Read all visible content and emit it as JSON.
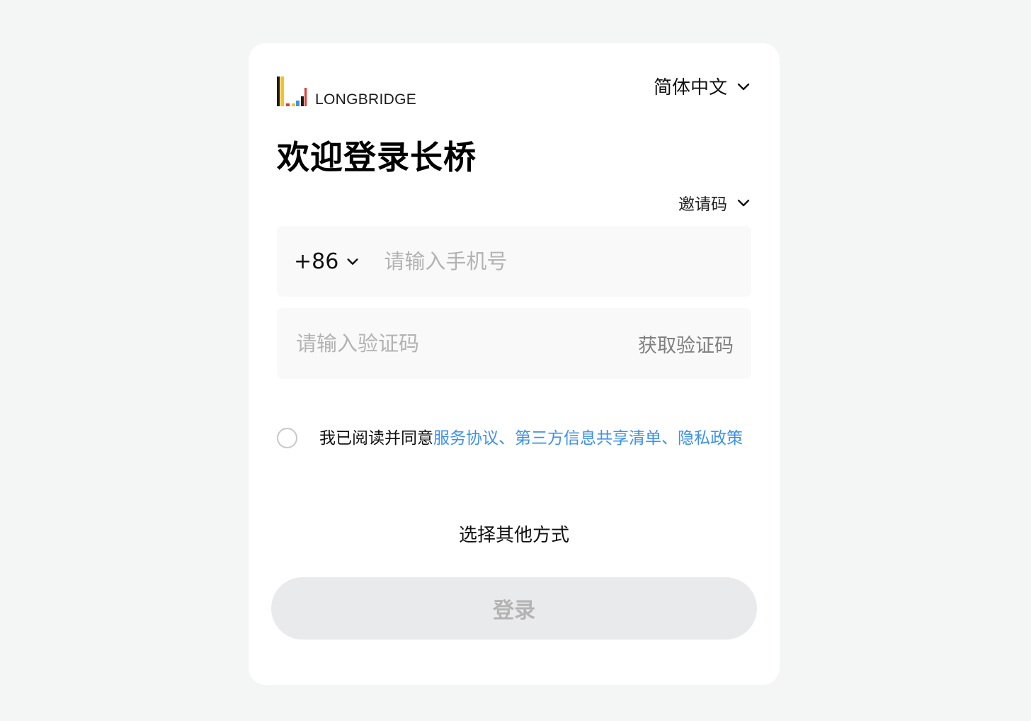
{
  "logo": {
    "text": "LONGBRIDGE",
    "colors": [
      "#f2c22e",
      "#e2382f",
      "#3e91e8",
      "#1a1a1a"
    ]
  },
  "language": {
    "label": "简体中文",
    "icon": "chevron-down-icon"
  },
  "title": "欢迎登录长桥",
  "invite": {
    "label": "邀请码",
    "icon": "chevron-down-icon"
  },
  "phone": {
    "country_code": "+86",
    "placeholder": "请输入手机号",
    "value": ""
  },
  "code": {
    "placeholder": "请输入验证码",
    "value": "",
    "get_code_label": "获取验证码"
  },
  "agreement": {
    "checked": false,
    "prefix": "我已阅读并同意",
    "links": [
      "服务协议",
      "第三方信息共享清单",
      "隐私政策"
    ],
    "separator": "、"
  },
  "other_methods": "选择其他方式",
  "login_button": "登录",
  "colors": {
    "page_bg": "#f4f5f5",
    "card_bg": "#ffffff",
    "link": "#3e91e8",
    "button_bg": "#e9eaeb",
    "button_text": "#b3b3b3"
  }
}
